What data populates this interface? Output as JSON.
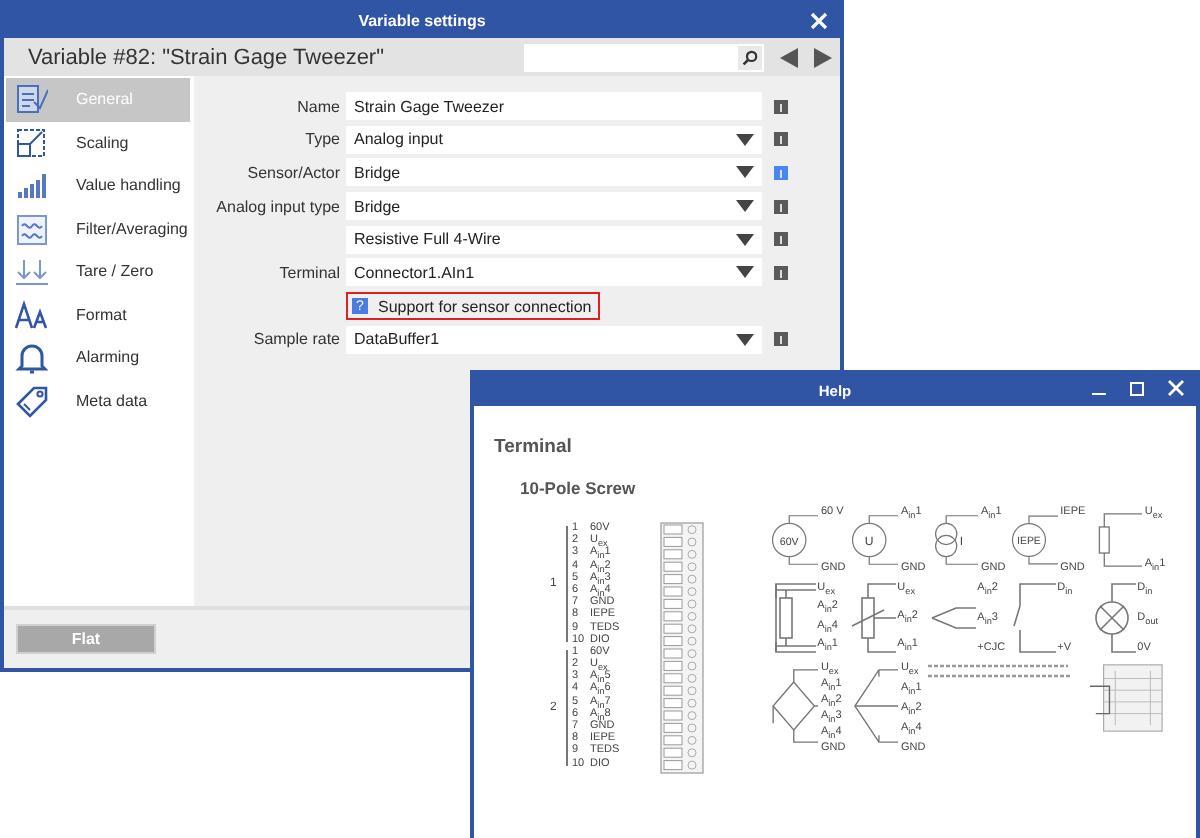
{
  "settings_window": {
    "title": "Variable settings",
    "heading": "Variable #82: \"Strain Gage Tweezer\"",
    "sidebar": {
      "items": [
        {
          "label": "General",
          "kind": "general",
          "selected": true
        },
        {
          "label": "Scaling",
          "kind": "scaling",
          "selected": false
        },
        {
          "label": "Value handling",
          "kind": "bars",
          "selected": false
        },
        {
          "label": "Filter/Averaging",
          "kind": "filter",
          "selected": false
        },
        {
          "label": "Tare / Zero",
          "kind": "tare",
          "selected": false
        },
        {
          "label": "Format",
          "kind": "format",
          "selected": false
        },
        {
          "label": "Alarming",
          "kind": "bell",
          "selected": false
        },
        {
          "label": "Meta data",
          "kind": "tag",
          "selected": false
        }
      ]
    },
    "form": {
      "rows": [
        {
          "kind": "text",
          "label": "Name",
          "value": "Strain Gage Tweezer",
          "info_active": false
        },
        {
          "kind": "dropdown",
          "label": "Type",
          "value": "Analog input",
          "info_active": false
        },
        {
          "kind": "dropdown",
          "label": "Sensor/Actor",
          "value": "Bridge",
          "info_active": true
        },
        {
          "kind": "dropdown",
          "label": "Analog input type",
          "value": "Bridge",
          "info_active": false
        },
        {
          "kind": "dropdown",
          "value": "Resistive Full 4-Wire",
          "info_active": false
        },
        {
          "kind": "dropdown",
          "label": "Terminal",
          "value": "Connector1.AIn1",
          "info_active": false
        },
        {
          "kind": "link",
          "icon_text": "?",
          "label": "Support for sensor connection",
          "highlighted": true
        },
        {
          "kind": "dropdown",
          "label": "Sample rate",
          "value": "DataBuffer1",
          "info_active": false
        }
      ]
    },
    "footer": {
      "button": {
        "label": "Flat",
        "disabled": true
      }
    }
  },
  "help_window": {
    "title": "Help",
    "heading": "Terminal",
    "subheading": "10-Pole Screw",
    "connectors": [
      {
        "label": "1",
        "pins": [
          {
            "number": "1",
            "name": "60V"
          },
          {
            "number": "2",
            "name": "U$_{ex}$"
          },
          {
            "number": "3",
            "name": "A$_{in}$1"
          },
          {
            "number": "4",
            "name": "A$_{in}$2"
          },
          {
            "number": "5",
            "name": "A$_{in}$3"
          },
          {
            "number": "6",
            "name": "A$_{in}$4"
          },
          {
            "number": "7",
            "name": "GND"
          },
          {
            "number": "8",
            "name": "IEPE"
          },
          {
            "number": "9",
            "name": "TEDS"
          },
          {
            "number": "10",
            "name": "DIO"
          }
        ]
      },
      {
        "label": "2",
        "pins": [
          {
            "number": "1",
            "name": "60V"
          },
          {
            "number": "2",
            "name": "U$_{ex}$"
          },
          {
            "number": "3",
            "name": "A$_{in}$5"
          },
          {
            "number": "4",
            "name": "A$_{in}$6"
          },
          {
            "number": "5",
            "name": "A$_{in}$7"
          },
          {
            "number": "6",
            "name": "A$_{in}$8"
          },
          {
            "number": "7",
            "name": "GND"
          },
          {
            "number": "8",
            "name": "IEPE"
          },
          {
            "number": "9",
            "name": "TEDS"
          },
          {
            "number": "10",
            "name": "DIO"
          }
        ]
      }
    ],
    "symbols": [
      {
        "kind": "source",
        "text": "60V",
        "labels": [
          "60 V",
          "GND"
        ]
      },
      {
        "kind": "source",
        "text": "U",
        "labels": [
          "A$_{in}$1",
          "GND"
        ]
      },
      {
        "kind": "current",
        "text": "I",
        "labels": [
          "A$_{in}$1",
          "GND"
        ]
      },
      {
        "kind": "source",
        "text": "IEPE",
        "labels": [
          "IEPE",
          "GND"
        ]
      },
      {
        "kind": "resistor",
        "labels": [
          "U$_{ex}$",
          "A$_{in}$1"
        ]
      },
      {
        "kind": "resistor4",
        "labels": [
          "U$_{ex}$",
          "A$_{in}$2",
          "A$_{in}$4",
          "A$_{in}$1"
        ]
      },
      {
        "kind": "potentiometer",
        "labels": [
          "U$_{ex}$",
          "A$_{in}$2",
          "A$_{in}$1"
        ]
      },
      {
        "kind": "thermocouple",
        "labels": [
          "A$_{in}$2",
          "A$_{in}$3",
          "+CJC"
        ]
      },
      {
        "kind": "switch",
        "labels": [
          "D$_{in}$",
          "+V"
        ]
      },
      {
        "kind": "lamp",
        "labels": [
          "D$_{in}$",
          "D$_{out}$",
          "0V"
        ]
      },
      {
        "kind": "bridge",
        "labels": [
          "U$_{ex}$",
          "A$_{in}$1",
          "A$_{in}$2",
          "A$_{in}$3",
          "A$_{in}$4",
          "GND"
        ]
      },
      {
        "kind": "halfbridge",
        "labels": [
          "U$_{ex}$",
          "A$_{in}$1",
          "A$_{in}$2",
          "A$_{in}$4",
          "GND"
        ]
      },
      {
        "kind": "note"
      },
      {
        "kind": "block"
      }
    ]
  }
}
